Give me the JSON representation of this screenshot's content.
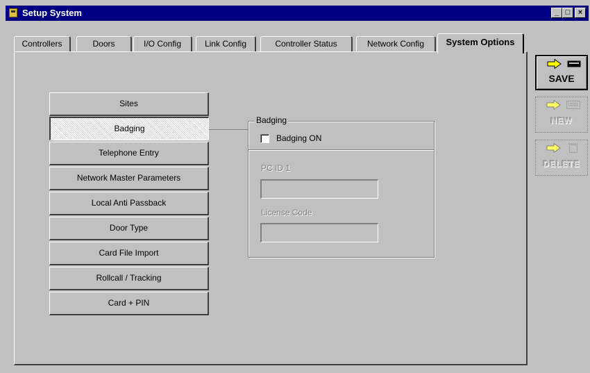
{
  "window": {
    "title": "Setup System",
    "controls": {
      "minimize": "_",
      "maximize": "□",
      "close": "×"
    }
  },
  "tabs": [
    {
      "label": "Controllers"
    },
    {
      "label": "Doors"
    },
    {
      "label": "I/O Config"
    },
    {
      "label": "Link Config"
    },
    {
      "label": "Controller Status"
    },
    {
      "label": "Network Config"
    },
    {
      "label": "System Options",
      "active": true
    }
  ],
  "options": [
    {
      "label": "Sites"
    },
    {
      "label": "Badging",
      "selected": true
    },
    {
      "label": "Telephone Entry"
    },
    {
      "label": "Network Master Parameters"
    },
    {
      "label": "Local Anti Passback"
    },
    {
      "label": "Door Type"
    },
    {
      "label": "Card File Import"
    },
    {
      "label": "Rollcall / Tracking"
    },
    {
      "label": "Card + PIN"
    }
  ],
  "badging": {
    "group_label": "Badging",
    "checkbox_label": "Badging ON",
    "checkbox_checked": false,
    "pc_id_label": "PC ID 1",
    "pc_id_value": "",
    "license_label": "License Code",
    "license_value": ""
  },
  "actions": {
    "save": "SAVE",
    "new": "NEW",
    "delete": "DELETE",
    "save_enabled": true,
    "new_enabled": false,
    "delete_enabled": false
  },
  "colors": {
    "face": "#c0c0c0",
    "titlebar": "#000080",
    "arrow": "#ffff00",
    "disabled_text": "#808080"
  }
}
